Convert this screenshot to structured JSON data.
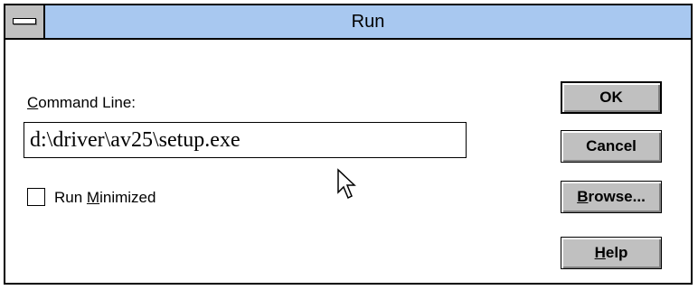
{
  "window": {
    "title": "Run"
  },
  "form": {
    "command_line_label_mnemonic": "C",
    "command_line_label_rest": "ommand Line:",
    "command_line_value": "d:\\driver\\av25\\setup.exe",
    "run_minimized_checked": false,
    "run_minimized_label_pre": "Run ",
    "run_minimized_label_mnemonic": "M",
    "run_minimized_label_rest": "inimized"
  },
  "buttons": {
    "ok": "OK",
    "cancel": "Cancel",
    "browse_mnemonic": "B",
    "browse_rest": "rowse...",
    "help_mnemonic": "H",
    "help_rest": "elp"
  },
  "icons": {
    "system_menu": "system-menu-icon",
    "cursor": "mouse-pointer-icon"
  },
  "colors": {
    "titlebar": "#a8c8f0",
    "button_face": "#c0c0c0",
    "window_bg": "#ffffff"
  }
}
